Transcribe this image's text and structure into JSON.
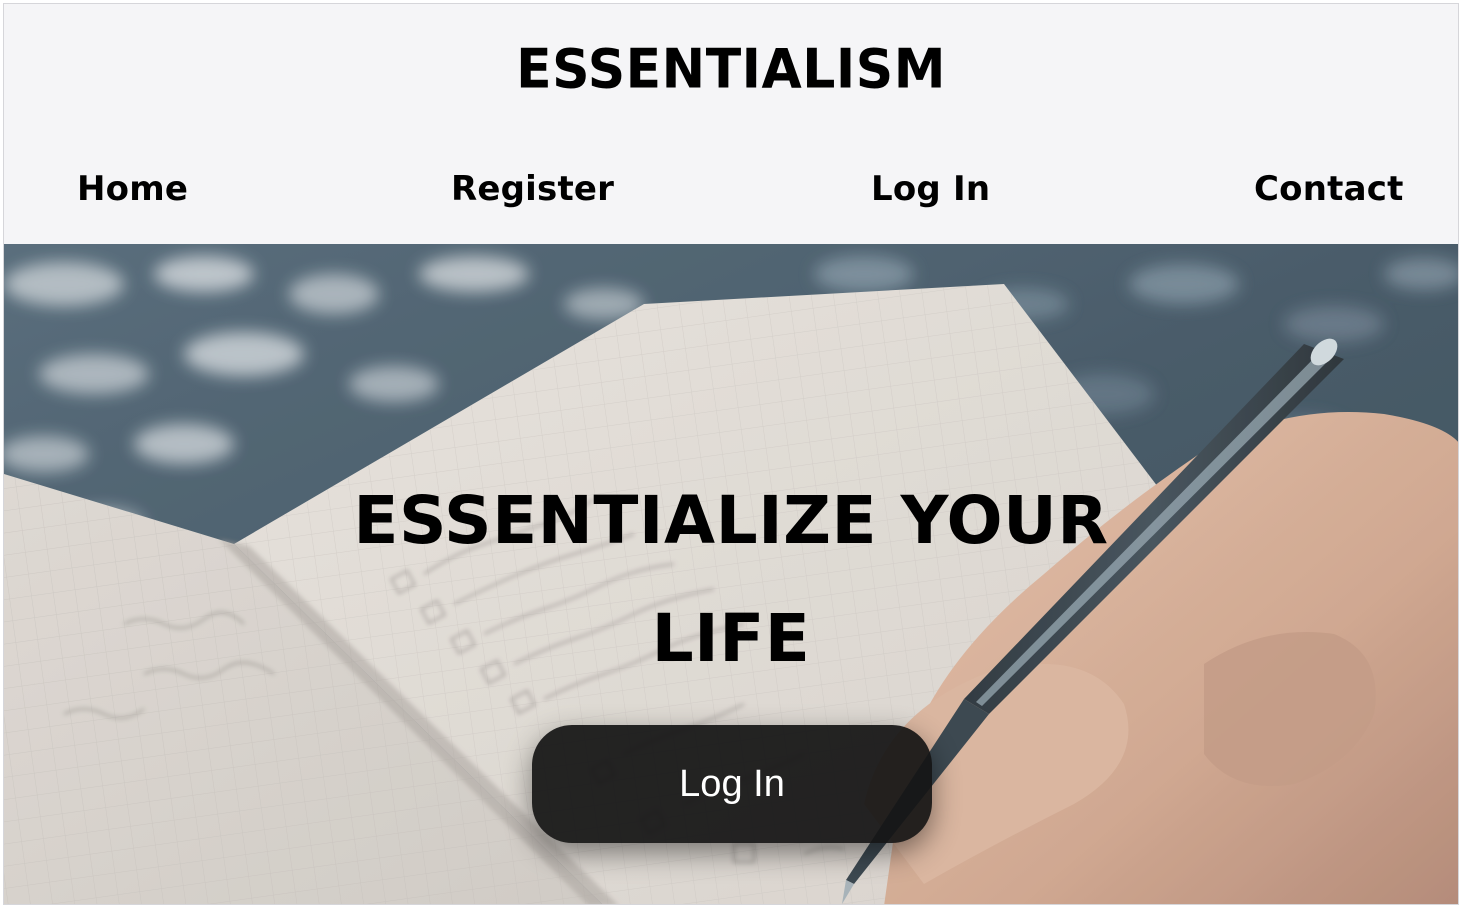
{
  "header": {
    "brand": "ESSENTIALISM",
    "nav": [
      {
        "label": "Home"
      },
      {
        "label": "Register"
      },
      {
        "label": "Log In"
      },
      {
        "label": "Contact"
      }
    ]
  },
  "hero": {
    "title": "ESSENTIALIZE YOUR LIFE",
    "button_label": "Log In",
    "background_image": "notebook-checklist-pen-photo"
  },
  "colors": {
    "header_bg": "#f5f5f7",
    "text": "#000000",
    "button_bg": "#141414",
    "button_text": "#ffffff"
  }
}
